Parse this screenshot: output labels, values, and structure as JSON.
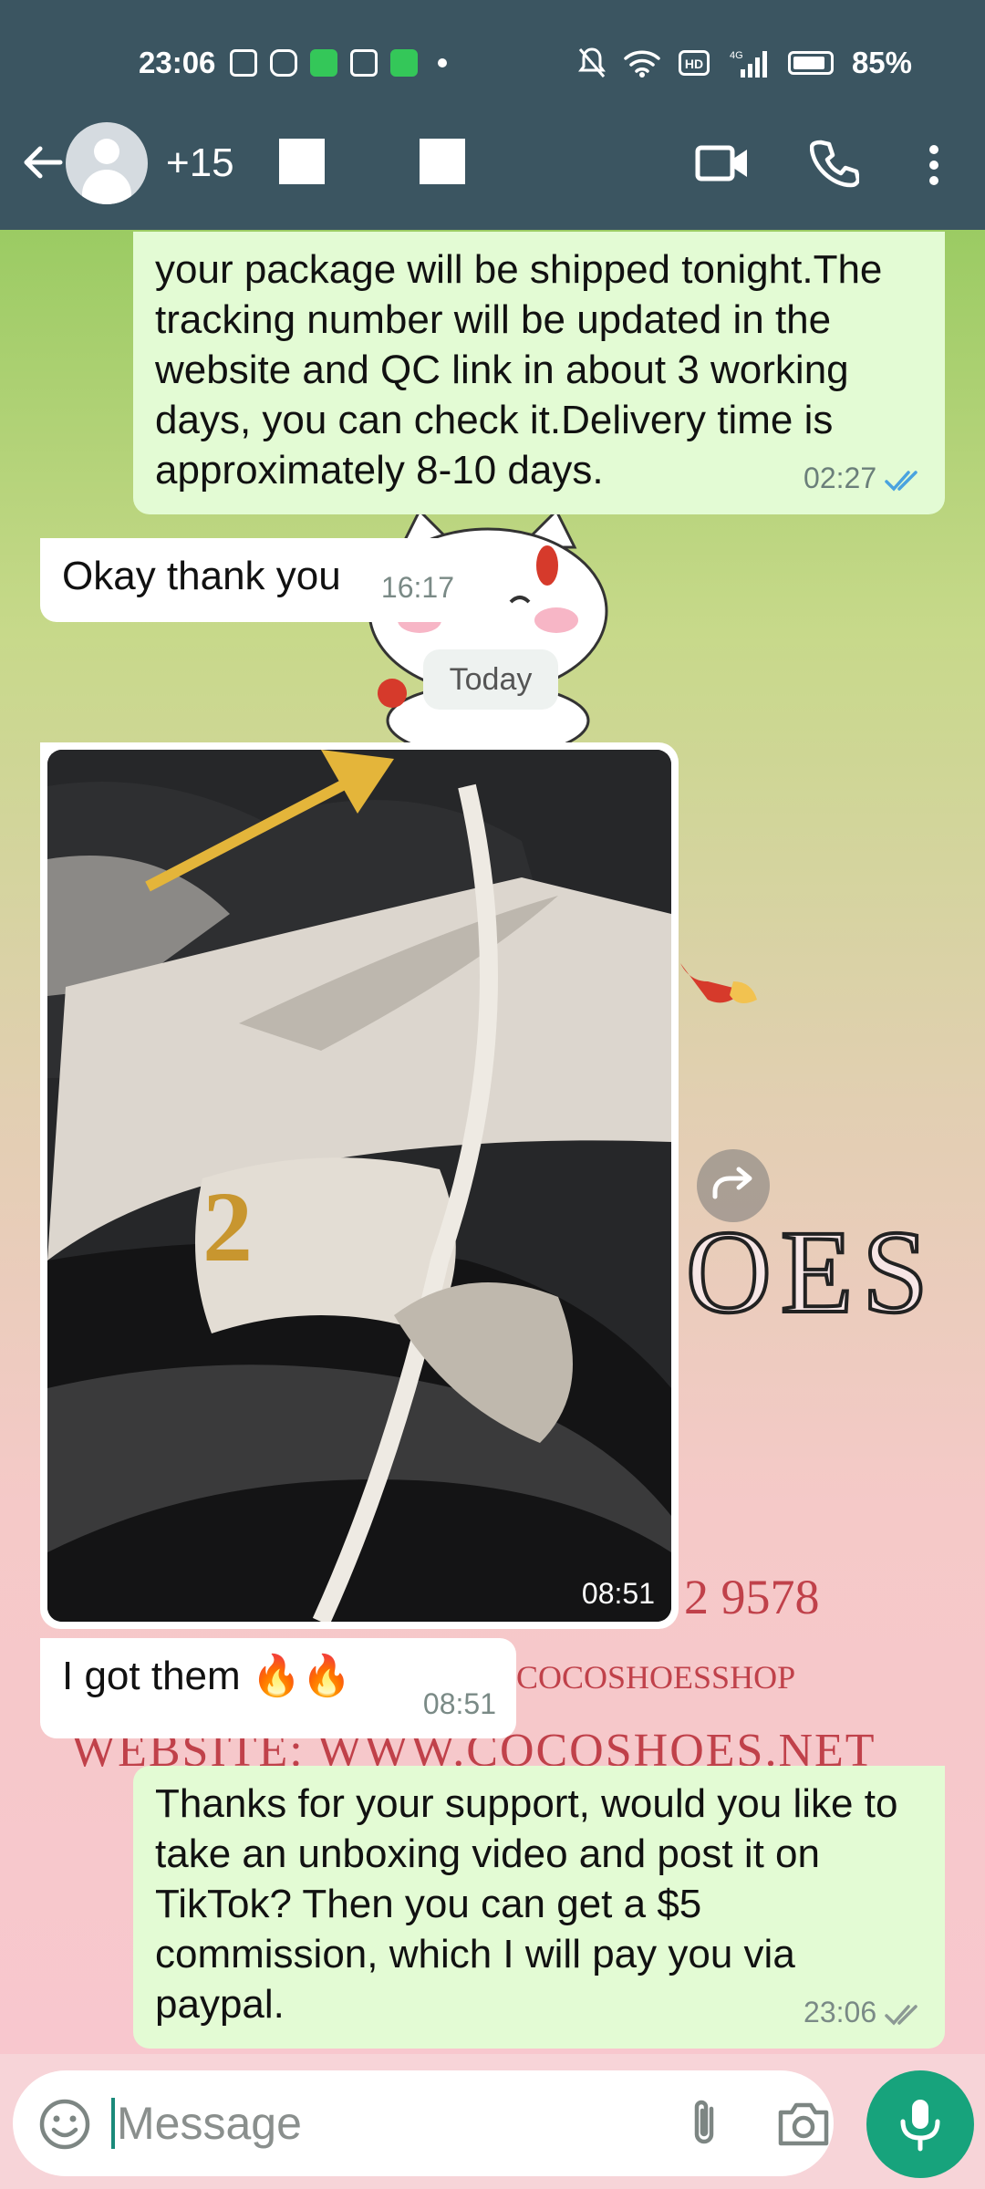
{
  "status_bar": {
    "time": "23:06",
    "battery": "85%",
    "network": "4G"
  },
  "header": {
    "contact": "+15",
    "icons": [
      "back-icon",
      "avatar",
      "video-call-icon",
      "voice-call-icon",
      "more-options-icon"
    ]
  },
  "messages": [
    {
      "id": "m1",
      "direction": "outgoing",
      "text": "your package will be shipped tonight.The tracking number will be updated in the website and QC link in about 3 working days, you can check it.Delivery time is approximately 8-10 days.",
      "time": "02:27",
      "status": "read"
    },
    {
      "id": "m2",
      "direction": "incoming",
      "text": "Okay thank you",
      "time": "16:17"
    },
    {
      "id": "m3",
      "direction": "incoming",
      "type": "image",
      "time": "08:51"
    },
    {
      "id": "m4",
      "direction": "incoming",
      "text": "I got them 🔥🔥",
      "time": "08:51"
    },
    {
      "id": "m5",
      "direction": "outgoing",
      "text": "Thanks for your support, would you like to take an unboxing video and post it on TikTok? Then you can get a $5 commission, which I will pay you via paypal.",
      "time": "23:06",
      "status": "delivered"
    }
  ],
  "date_separator": "Today",
  "wallpaper": {
    "oes": "OES",
    "phone_fragment": "2 9578",
    "shop": "COCOSHOESSHOP",
    "website": "WEBSITE: WWW.COCOSHOES.NET"
  },
  "composer": {
    "placeholder": "Message"
  },
  "colors": {
    "header": "#3b5561",
    "outgoing_bubble": "#e3fbd4",
    "incoming_bubble": "#ffffff",
    "accent": "#17a37c",
    "read_tick": "#4aa3df"
  }
}
